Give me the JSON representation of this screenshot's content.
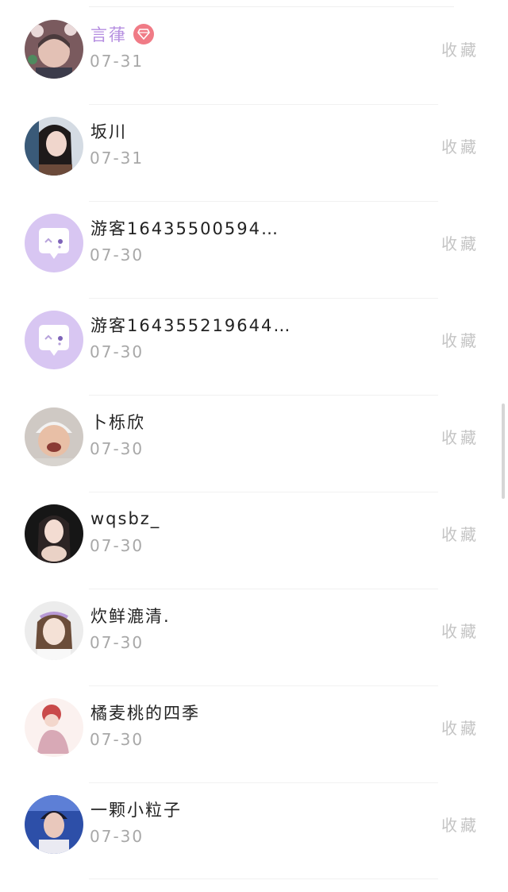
{
  "list": {
    "items": [
      {
        "name": "言葎",
        "date": "07-31",
        "action": "收藏",
        "vip": true
      },
      {
        "name": "坂川",
        "date": "07-31",
        "action": "收藏",
        "vip": false
      },
      {
        "name": "游客16435500594…",
        "date": "07-30",
        "action": "收藏",
        "vip": false
      },
      {
        "name": "游客164355219644…",
        "date": "07-30",
        "action": "收藏",
        "vip": false
      },
      {
        "name": "卜栎欣",
        "date": "07-30",
        "action": "收藏",
        "vip": false
      },
      {
        "name": "wqsbz_",
        "date": "07-30",
        "action": "收藏",
        "vip": false
      },
      {
        "name": "炊鲜漉清.",
        "date": "07-30",
        "action": "收藏",
        "vip": false
      },
      {
        "name": "橘麦桃的四季",
        "date": "07-30",
        "action": "收藏",
        "vip": false
      },
      {
        "name": "一颗小粒子",
        "date": "07-30",
        "action": "收藏",
        "vip": false
      }
    ]
  },
  "colors": {
    "vip_name": "#b58ee0",
    "vip_badge": "#f07b86",
    "guest_avatar_bg": "#d8c6f2",
    "date_text": "#a8a8a8",
    "action_text": "#c4c4c4"
  },
  "icons": {
    "vip": "diamond-icon",
    "guest_avatar": "chat-bubble-icon"
  }
}
